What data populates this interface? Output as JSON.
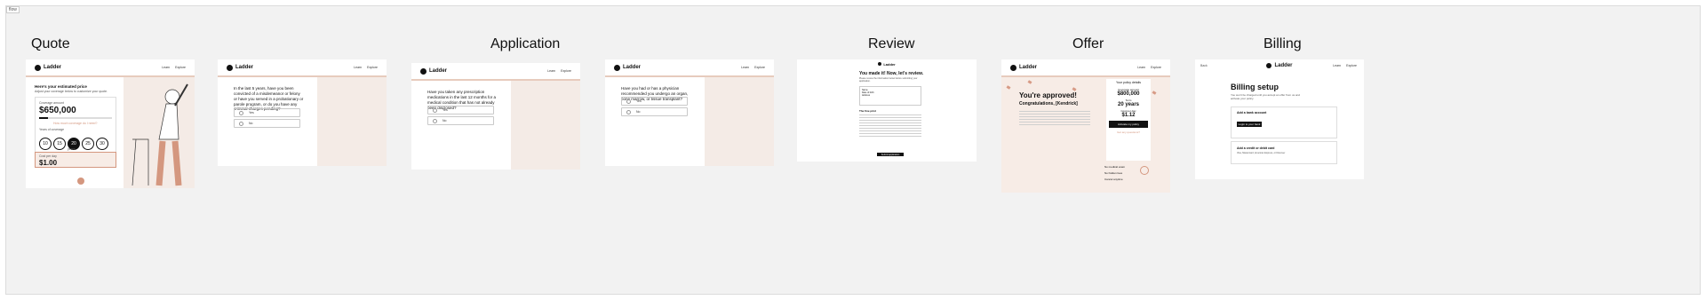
{
  "tag": "flow",
  "sections": {
    "quote": "Quote",
    "application": "Application",
    "review": "Review",
    "offer": "Offer",
    "billing": "Billing"
  },
  "brand": "Ladder",
  "nav": {
    "learn": "Learn",
    "explore": "Explore"
  },
  "quote": {
    "intro": "Here's your estimated price",
    "sub": "Adjust your coverage below to customize your quote.",
    "coverage_label": "Coverage amount",
    "coverage_value": "$650,000",
    "link": "How much coverage do I need?",
    "years_label": "Years of coverage",
    "years": [
      "10",
      "15",
      "20",
      "25",
      "30",
      "W"
    ],
    "years_sel": "20",
    "years_caption": "years",
    "cost_label": "Cost per day",
    "cost_value": "$1.00"
  },
  "app1": {
    "question": "In the last 5 years, have you been convicted of a misdemeanor or felony or have you served in a probationary or parole program, or do you have any criminal charges pending?",
    "opts": [
      "Yes",
      "No"
    ]
  },
  "app2": {
    "question": "Have you taken any prescription medications in the last 12 months for a medical condition that has not already been disclosed?",
    "opts": [
      "Yes",
      "No"
    ]
  },
  "app3": {
    "question": "Have you had or has a physician recommended you undergo an organ, bone marrow, or tissue transplant?",
    "opts": [
      "Yes",
      "No"
    ]
  },
  "review": {
    "title": "You made it! Now, let's review.",
    "sub": "Please review the information below before submitting your application.",
    "fields": [
      "Name",
      "Date of birth",
      "Address"
    ],
    "edit": "Edit",
    "fine_title": "The fine print",
    "button": "Submit application"
  },
  "offer": {
    "title": "You're approved!",
    "greeting": "Congratulations, [Kendrick]",
    "policy_title": "Your policy details",
    "coverage_label": "Coverage amount",
    "coverage_value": "$800,000",
    "term_label": "Term",
    "term_value": "20 years",
    "price_label": "Cost per day",
    "price_value": "$1.12",
    "activate": "Activate my policy",
    "questions": "Got any questions?",
    "reasons": [
      "No medical exam",
      "No hidden fees",
      "Cancel anytime"
    ]
  },
  "billing": {
    "back": "Back",
    "title": "Billing setup",
    "sub": "You won't be charged until you accept an offer from us and activate your policy.",
    "bank_title": "Add a bank account",
    "bank_btn": "Login to your bank",
    "card_title": "Add a credit or debit card",
    "card_sub": "Visa, Mastercard, American Express, or Discover"
  },
  "colors": {
    "peach": "#e7cbbd",
    "accent": "#d4977f",
    "dark": "#111111",
    "bg": "#f2f2f2"
  }
}
